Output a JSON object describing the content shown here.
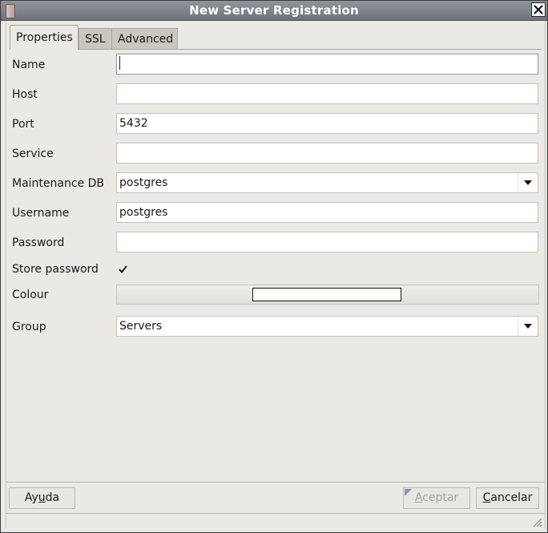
{
  "window": {
    "title": "New Server Registration"
  },
  "tabs": [
    {
      "label": "Properties"
    },
    {
      "label": "SSL"
    },
    {
      "label": "Advanced"
    }
  ],
  "form": {
    "name": {
      "label": "Name",
      "value": ""
    },
    "host": {
      "label": "Host",
      "value": ""
    },
    "port": {
      "label": "Port",
      "value": "5432"
    },
    "service": {
      "label": "Service",
      "value": ""
    },
    "maintenance_db": {
      "label": "Maintenance DB",
      "value": "postgres"
    },
    "username": {
      "label": "Username",
      "value": "postgres"
    },
    "password": {
      "label": "Password",
      "value": ""
    },
    "store_password": {
      "label": "Store password",
      "checked": true
    },
    "colour": {
      "label": "Colour",
      "swatch_color": "#ffffff"
    },
    "group": {
      "label": "Group",
      "value": "Servers"
    }
  },
  "buttons": {
    "help": {
      "pre": "Ay",
      "mnemonic": "u",
      "post": "da"
    },
    "ok": {
      "pre": "",
      "mnemonic": "A",
      "post": "ceptar",
      "enabled": false
    },
    "cancel": {
      "pre": "",
      "mnemonic": "C",
      "post": "ancelar"
    }
  }
}
